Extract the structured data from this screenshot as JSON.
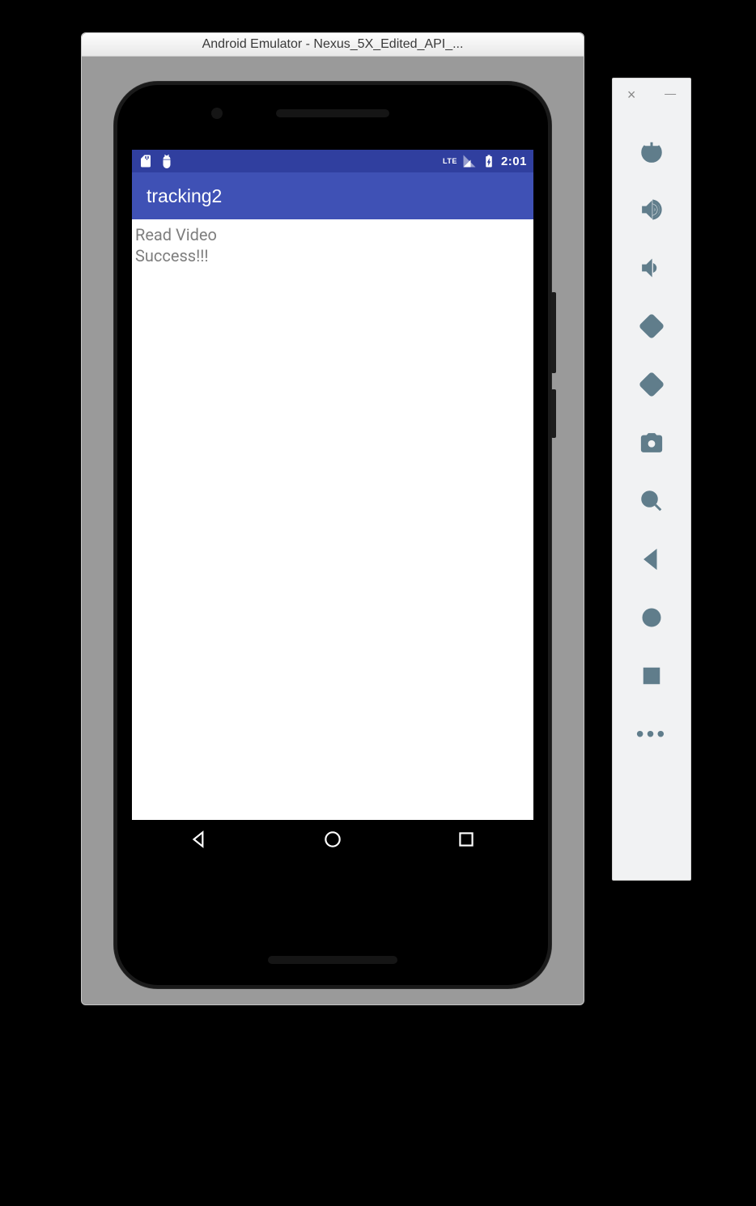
{
  "window": {
    "title": "Android Emulator - Nexus_5X_Edited_API_..."
  },
  "statusbar": {
    "network_label": "LTE",
    "time": "2:01"
  },
  "app": {
    "title": "tracking2",
    "content_line1": "Read Video",
    "content_line2": "Success!!!"
  },
  "toolbar": {
    "close": "×",
    "minimize": "—"
  }
}
